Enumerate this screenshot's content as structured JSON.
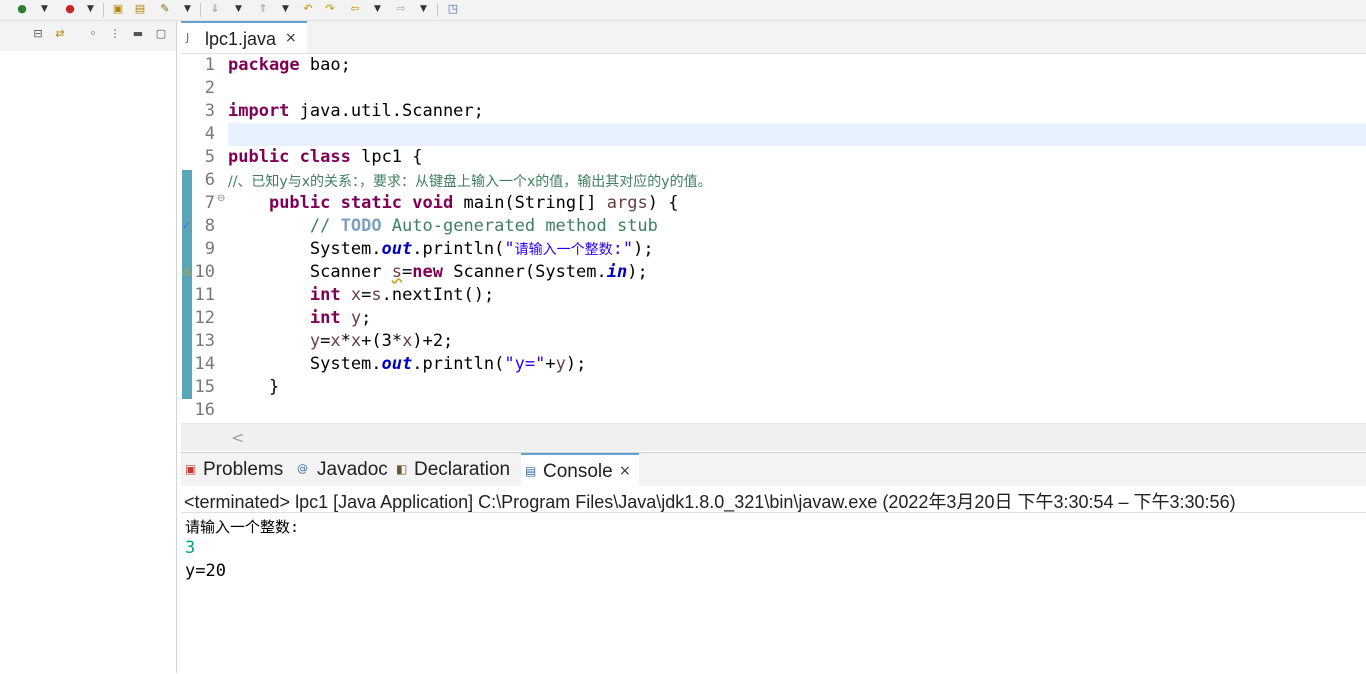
{
  "toolbar": {
    "icons": [
      "debug-run-icon",
      "run-icon",
      "coverage-icon",
      "open-type-icon",
      "open-folder-icon",
      "search-icon",
      "next-annotation-icon",
      "prev-annotation-icon",
      "last-edit-icon",
      "back-icon",
      "forward-icon",
      "pin-editor-icon"
    ]
  },
  "left_view": {
    "icons": [
      "collapse-all-icon",
      "link-editor-icon",
      "filter-icon",
      "view-menu-icon",
      "minimize-icon",
      "maximize-icon"
    ]
  },
  "editor": {
    "tab_label": "lpc1.java",
    "close_glyph": "×",
    "lines": [
      {
        "num": "1",
        "text": "package bao;"
      },
      {
        "num": "2",
        "text": ""
      },
      {
        "num": "3",
        "text": "import java.util.Scanner;"
      },
      {
        "num": "4",
        "text": ""
      },
      {
        "num": "5",
        "text": "public class lpc1 {"
      },
      {
        "num": "6",
        "text": "//、已知y与x的关系：，要求：从键盘上输入一个x的值，输出其对应的y的值。"
      },
      {
        "num": "7",
        "text": "    public static void main(String[] args) {"
      },
      {
        "num": "8",
        "text": "        // TODO Auto-generated method stub"
      },
      {
        "num": "9",
        "text": "        System.out.println(\"请输入一个整数:\");"
      },
      {
        "num": "10",
        "text": "        Scanner s=new Scanner(System.in);"
      },
      {
        "num": "11",
        "text": "        int x=s.nextInt();"
      },
      {
        "num": "12",
        "text": "        int y;"
      },
      {
        "num": "13",
        "text": "        y=x*x+(3*x)+2;"
      },
      {
        "num": "14",
        "text": "        System.out.println(\"y=\"+y);"
      },
      {
        "num": "15",
        "text": "    }"
      },
      {
        "num": "16",
        "text": ""
      }
    ],
    "scroll_left_glyph": "<"
  },
  "console": {
    "tabs": [
      {
        "label": "Problems",
        "icon": "problems-icon"
      },
      {
        "label": "Javadoc",
        "icon": "javadoc-icon"
      },
      {
        "label": "Declaration",
        "icon": "declaration-icon"
      },
      {
        "label": "Console",
        "icon": "console-icon"
      }
    ],
    "close_glyph": "×",
    "status": "<terminated> lpc1 [Java Application] C:\\Program Files\\Java\\jdk1.8.0_321\\bin\\javaw.exe  (2022年3月20日 下午3:30:54 – 下午3:30:56)",
    "output": [
      {
        "text": "请输入一个整数:",
        "color": "#000000"
      },
      {
        "text": "3",
        "color": "#00a383"
      },
      {
        "text": "y=20",
        "color": "#000000"
      }
    ]
  }
}
